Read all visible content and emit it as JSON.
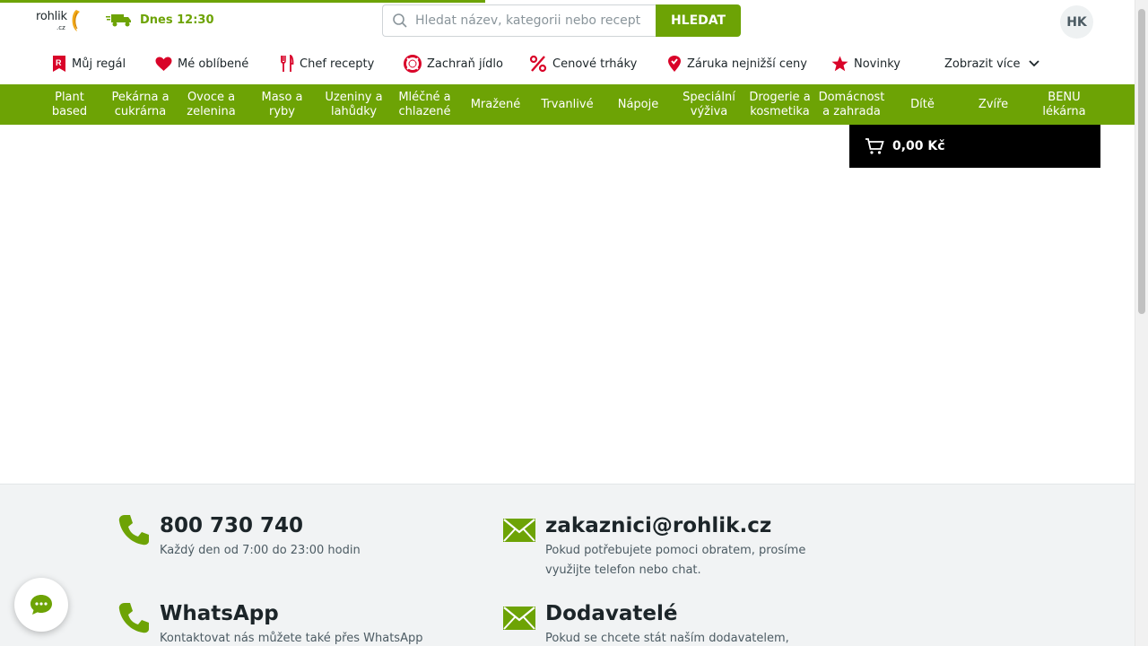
{
  "header": {
    "logo_text": "rohlik",
    "logo_suffix": ".cz",
    "delivery_text": "Dnes 12:30",
    "search_placeholder": "Hledat název, kategorii nebo recept",
    "search_value": "",
    "search_button": "HLEDAT",
    "avatar_initials": "HK"
  },
  "subnav": {
    "items": [
      {
        "label": "Můj regál",
        "icon": "regal-icon"
      },
      {
        "label": "Mé oblíbené",
        "icon": "heart-icon"
      },
      {
        "label": "Chef recepty",
        "icon": "cutlery-icon"
      },
      {
        "label": "Zachraň jídlo",
        "icon": "lifebuoy-icon"
      },
      {
        "label": "Cenové trháky",
        "icon": "percent-icon"
      },
      {
        "label": "Záruka nejnižší ceny",
        "icon": "pin-icon"
      },
      {
        "label": "Novinky",
        "icon": "star-icon"
      }
    ],
    "more_label": "Zobrazit více"
  },
  "categories": [
    {
      "line1": "Plant",
      "line2": "based"
    },
    {
      "line1": "Pekárna a",
      "line2": "cukrárna"
    },
    {
      "line1": "Ovoce a",
      "line2": "zelenina"
    },
    {
      "line1": "Maso a",
      "line2": "ryby"
    },
    {
      "line1": "Uzeniny a",
      "line2": "lahůdky"
    },
    {
      "line1": "Mléčné a",
      "line2": "chlazené"
    },
    {
      "line1": "Mražené",
      "line2": ""
    },
    {
      "line1": "Trvanlivé",
      "line2": ""
    },
    {
      "line1": "Nápoje",
      "line2": ""
    },
    {
      "line1": "Speciální",
      "line2": "výživa"
    },
    {
      "line1": "Drogerie a",
      "line2": "kosmetika"
    },
    {
      "line1": "Domácnost",
      "line2": "a zahrada"
    },
    {
      "line1": "Dítě",
      "line2": ""
    },
    {
      "line1": "Zvíře",
      "line2": ""
    },
    {
      "line1": "BENU",
      "line2": "lékárna"
    }
  ],
  "cart": {
    "total": "0,00 Kč"
  },
  "footer": {
    "phone": {
      "title": "800 730 740",
      "desc": "Každý den od 7:00 do 23:00 hodin"
    },
    "email": {
      "title": "zakaznici@rohlik.cz",
      "desc": "Pokud potřebujete pomoci obratem, prosíme využijte telefon nebo chat."
    },
    "whatsapp": {
      "title": "WhatsApp",
      "desc": "Kontaktovat nás můžete také přes WhatsApp na"
    },
    "suppliers": {
      "title": "Dodavatelé",
      "desc": "Pokud se chcete stát naším dodavatelem, klikněte"
    }
  },
  "colors": {
    "brand_green": "#6da305",
    "cart_bg": "#000000",
    "red_icon": "#d90429"
  }
}
